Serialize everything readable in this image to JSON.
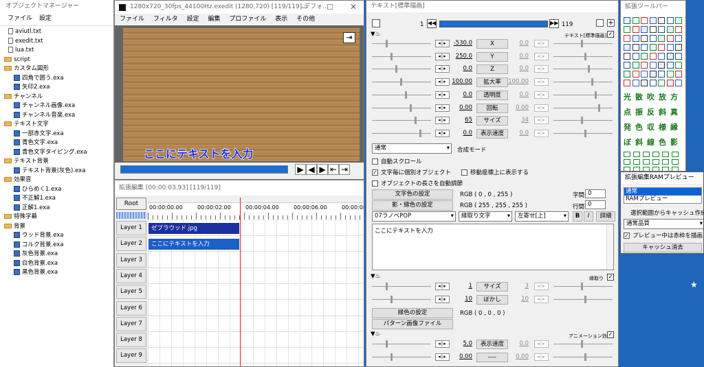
{
  "colors": {
    "desktop": "#1f66b8",
    "timebar": "#1a6ed8",
    "clip1": "#1c2ea0",
    "clip2": "#1b5fc8",
    "cursor": "#e02020",
    "wood": "#b88c58"
  },
  "om": {
    "title": "オブジェクトマネージャー",
    "menu": [
      "ファイル",
      "設定"
    ],
    "items": [
      {
        "t": "file",
        "l": "aviutl.txt"
      },
      {
        "t": "file",
        "l": "exedit.txt"
      },
      {
        "t": "file",
        "l": "lua.txt"
      },
      {
        "t": "folder",
        "l": "script"
      },
      {
        "t": "folder",
        "l": "カスタム図形"
      },
      {
        "t": "exa",
        "l": "四角で囲う.exa"
      },
      {
        "t": "exa",
        "l": "矢印2.exa"
      },
      {
        "t": "folder",
        "l": "チャンネル"
      },
      {
        "t": "exa",
        "l": "チャンネル画像.exa"
      },
      {
        "t": "exa",
        "l": "チャンネル音楽.exa"
      },
      {
        "t": "folder",
        "l": "テキスト文字"
      },
      {
        "t": "exa",
        "l": "一部赤文字.exa"
      },
      {
        "t": "exa",
        "l": "青色文字.exa"
      },
      {
        "t": "exa",
        "l": "青色文字タイピング.exa"
      },
      {
        "t": "folder",
        "l": "テキスト背景"
      },
      {
        "t": "exa",
        "l": "テキスト背景(灰色).exa"
      },
      {
        "t": "folder",
        "l": "効果音"
      },
      {
        "t": "exa",
        "l": "ひらめく1.exa"
      },
      {
        "t": "exa",
        "l": "不正解1.exa"
      },
      {
        "t": "exa",
        "l": "正解1.exa"
      },
      {
        "t": "folder",
        "l": "特殊字幕"
      },
      {
        "t": "folder",
        "l": "背景"
      },
      {
        "t": "exa",
        "l": "ウッド背景.exa"
      },
      {
        "t": "exa",
        "l": "コルク背景.exa"
      },
      {
        "t": "exa",
        "l": "灰色背景.exa"
      },
      {
        "t": "exa",
        "l": "白色背景.exa"
      },
      {
        "t": "exa",
        "l": "黒色背景.exa"
      }
    ]
  },
  "pv": {
    "title": "1280x720_30fps_44100Hz.exedit (1280,720)  [119/119]  デフォ...",
    "menu": [
      "ファイル",
      "フィルタ",
      "設定",
      "編集",
      "プロファイル",
      "表示",
      "その他"
    ],
    "caption": "ここにテキストを入力",
    "buttons": [
      "play",
      "prev-frame",
      "next-frame",
      "to-start",
      "to-end"
    ]
  },
  "tl": {
    "title": "拡張編集 [00:00:03.93] [119/119]",
    "root": "Root",
    "times": [
      "00:00:00.00",
      "00:00:02.00",
      "00:00:04.00",
      "00:00:06.00",
      "00:00:08.00"
    ],
    "layers": [
      "Layer 1",
      "Layer 2",
      "Layer 3",
      "Layer 4",
      "Layer 5",
      "Layer 6",
      "Layer 7",
      "Layer 8",
      "Layer 9"
    ],
    "clips": [
      {
        "layer": 0,
        "label": "ゼブラウッド.jpg",
        "kind": "image"
      },
      {
        "layer": 1,
        "label": "ここにテキストを入力",
        "kind": "text"
      }
    ]
  },
  "td": {
    "title": "テキスト[標準描画]",
    "frame_start": "1",
    "frame_end": "119",
    "header_label": "テキスト[標準描画]",
    "params": [
      {
        "name": "X",
        "l": "-530.0",
        "r": "0.0"
      },
      {
        "name": "Y",
        "l": "250.0",
        "r": "0.0"
      },
      {
        "name": "Z",
        "l": "0.0",
        "r": "0.0"
      },
      {
        "name": "拡大率",
        "l": "100.00",
        "r": "100.00"
      },
      {
        "name": "透明度",
        "l": "0.0",
        "r": "0.0"
      },
      {
        "name": "回転",
        "l": "0.00",
        "r": "0.00"
      },
      {
        "name": "サイズ",
        "l": "65",
        "r": "34"
      },
      {
        "name": "表示速度",
        "l": "0.0",
        "r": "0.0"
      }
    ],
    "blend": "通常",
    "blend_label": "合成モード",
    "cb_autoscroll": "自動スクロール",
    "cb_individual": "文字毎に個別オブジェクト",
    "cb_coords": "移動座標上に表示する",
    "cb_autolen": "オブジェクトの長さを自動調節",
    "btn_fontcolor": "文字色の設定",
    "btn_shadowcolor": "影・縁色の設定",
    "rgb1": "RGB ( 0 , 0 , 255 )",
    "rgb2": "RGB ( 255 , 255 , 255 )",
    "spacing_label": "字間",
    "spacing": "0",
    "linesp_label": "行間",
    "linesp": "0",
    "font": "07ラノベPOP",
    "deco": "縁取り文字",
    "align": "左寄せ[上]",
    "bold": "B",
    "italic": "I",
    "detail": "詳細",
    "text": "ここにテキストを入力",
    "filter1_label": "縁取り",
    "f1": [
      {
        "name": "サイズ",
        "l": "1",
        "r": "3"
      },
      {
        "name": "ぼかし",
        "l": "10",
        "r": "10"
      }
    ],
    "btn_edgecolor": "縁色の設定",
    "rgb3": "RGB ( 0 , 0 , 0 )",
    "btn_pattern": "パターン画像ファイル",
    "filter2_label": "アニメーション効果",
    "f2": [
      {
        "name": "表示速度",
        "l": "5.0",
        "r": "0.0"
      },
      {
        "name": "----",
        "l": "0.00",
        "r": "0.00"
      }
    ]
  },
  "toolbar": {
    "title": "拡張ツールバー",
    "kanji": [
      "光",
      "散",
      "吹",
      "放",
      "方",
      "点",
      "振",
      "反",
      "斜",
      "真",
      "発",
      "色",
      "収",
      "様",
      "縁",
      "ぼ",
      "斜",
      "線",
      "色",
      "影"
    ]
  },
  "ram": {
    "title": "拡張編集RAMプレビュー",
    "list": [
      "通常",
      "RAMプレビュー"
    ],
    "btn_cache": "選択範囲からキャッシュ作成",
    "quality": "通常品質",
    "cb_preview": "プレビュー中は赤枠を描画",
    "btn_clear": "キャッシュ消去"
  }
}
